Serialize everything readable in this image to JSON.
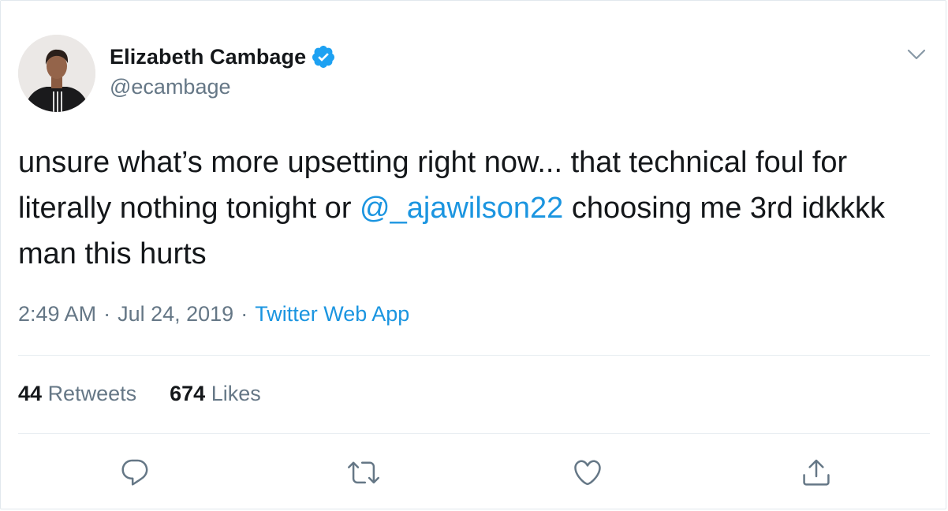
{
  "author": {
    "display_name": "Elizabeth Cambage",
    "handle": "@ecambage",
    "verified": true,
    "avatar_icon": "profile-photo"
  },
  "tweet": {
    "text_before": "unsure what’s more upsetting right now... that technical foul for literally nothing tonight or ",
    "mention": "@_ajawilson22",
    "text_after": " choosing me 3rd idkkkk man this hurts"
  },
  "meta": {
    "time": "2:49 AM",
    "separator": "·",
    "date": "Jul 24, 2019",
    "source": "Twitter Web App"
  },
  "stats": {
    "retweets_count": "44",
    "retweets_label": "Retweets",
    "likes_count": "674",
    "likes_label": "Likes"
  },
  "actions": [
    "reply-icon",
    "retweet-icon",
    "like-icon",
    "share-icon"
  ],
  "colors": {
    "link": "#1b95e0",
    "secondary_text": "#657786",
    "primary_text": "#14171a",
    "verified_badge": "#1da1f2",
    "divider": "#e6ecf0"
  }
}
